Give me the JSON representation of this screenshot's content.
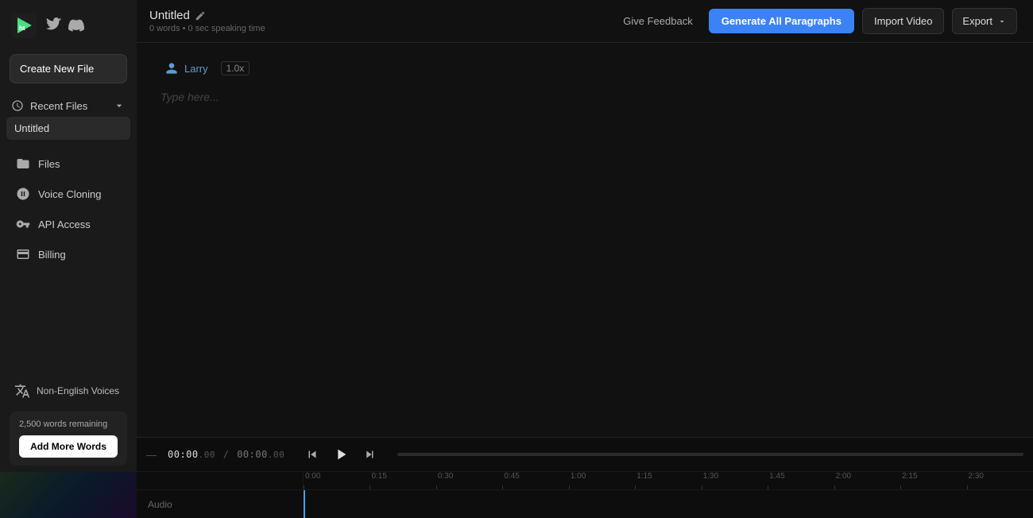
{
  "sidebar": {
    "logo_alt": "PlayHT Logo",
    "create_new_label": "Create New File",
    "recent_files_label": "Recent Files",
    "recent_file_name": "Untitled",
    "nav_items": [
      {
        "id": "files",
        "label": "Files",
        "icon": "folder-icon"
      },
      {
        "id": "voice-cloning",
        "label": "Voice Cloning",
        "icon": "star-icon"
      },
      {
        "id": "api-access",
        "label": "API Access",
        "icon": "key-icon"
      },
      {
        "id": "billing",
        "label": "Billing",
        "icon": "card-icon"
      }
    ],
    "non_english_label": "Non-English Voices",
    "words_remaining": "2,500 words remaining",
    "add_words_label": "Add More Words"
  },
  "header": {
    "file_title": "Untitled",
    "file_meta": "0 words • 0 sec speaking time",
    "feedback_label": "Give Feedback",
    "generate_label": "Generate All Paragraphs",
    "import_label": "Import Video",
    "export_label": "Export"
  },
  "editor": {
    "voice_name": "Larry",
    "speed": "1.0x",
    "placeholder": "Type here..."
  },
  "transport": {
    "dash": "—",
    "time_current": "00:00",
    "time_current_sub": ".00",
    "time_separator": "/",
    "time_total": "00:00",
    "time_total_sub": ".00"
  },
  "timeline": {
    "marks": [
      "0:00",
      "0:15",
      "0:30",
      "0:45",
      "1:00",
      "1:15",
      "1:30",
      "1:45",
      "2:00",
      "2:15",
      "2:30"
    ],
    "track_label": "Audio",
    "playhead_pct": 0
  }
}
